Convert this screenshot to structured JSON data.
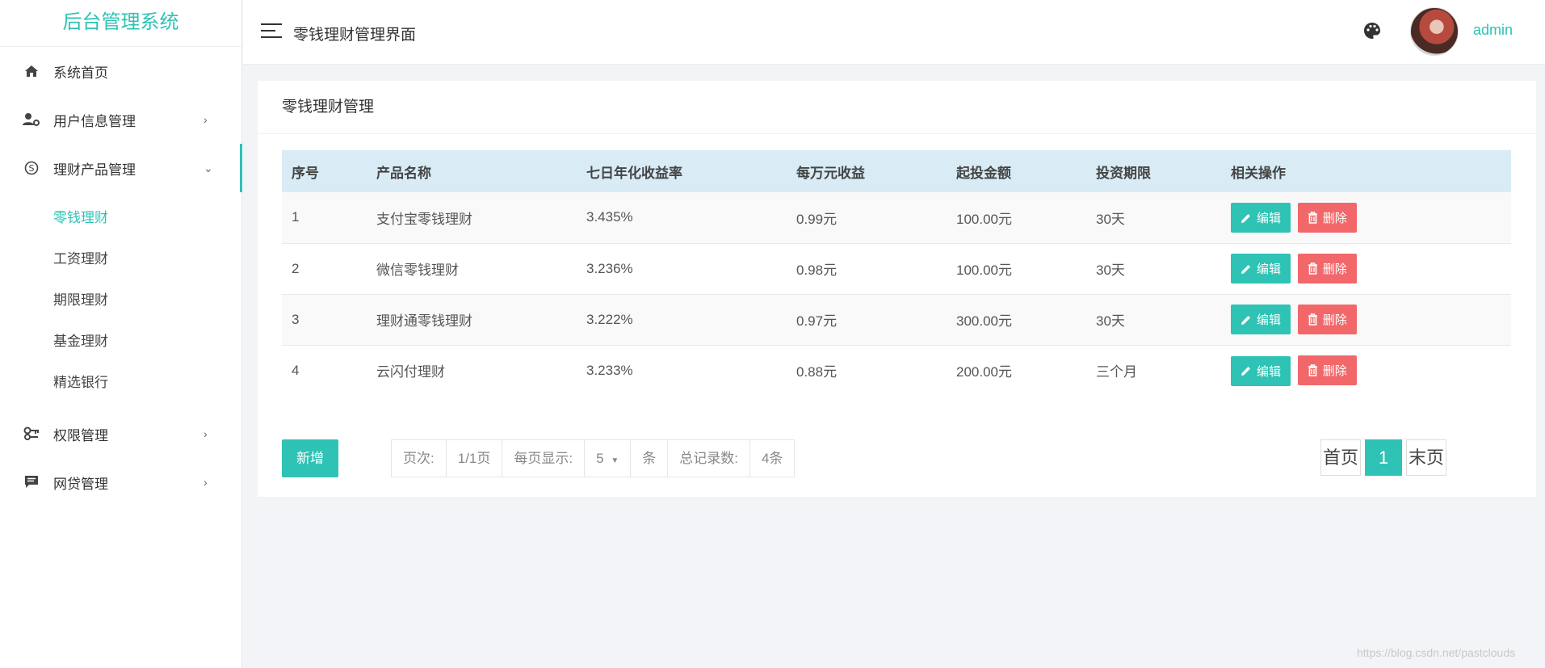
{
  "sidebar": {
    "title": "后台管理系统",
    "items": [
      {
        "label": "系统首页",
        "icon": "home-icon"
      },
      {
        "label": "用户信息管理",
        "icon": "user-gear-icon",
        "chevron": "›"
      },
      {
        "label": "理财产品管理",
        "icon": "skype-icon",
        "chevron": "⌄"
      },
      {
        "label": "权限管理",
        "icon": "key-icon",
        "chevron": "›"
      },
      {
        "label": "网贷管理",
        "icon": "comment-icon",
        "chevron": "›"
      }
    ],
    "subitems": [
      "零钱理财",
      "工资理财",
      "期限理财",
      "基金理财",
      "精选银行"
    ]
  },
  "header": {
    "title": "零钱理财管理界面",
    "username": "admin"
  },
  "card": {
    "title": "零钱理财管理"
  },
  "table": {
    "columns": [
      "序号",
      "产品名称",
      "七日年化收益率",
      "每万元收益",
      "起投金额",
      "投资期限",
      "相关操作"
    ],
    "rows": [
      {
        "id": "1",
        "name": "支付宝零钱理财",
        "rate": "3.435%",
        "profit": "0.99元",
        "min": "100.00元",
        "term": "30天"
      },
      {
        "id": "2",
        "name": "微信零钱理财",
        "rate": "3.236%",
        "profit": "0.98元",
        "min": "100.00元",
        "term": "30天"
      },
      {
        "id": "3",
        "name": "理财通零钱理财",
        "rate": "3.222%",
        "profit": "0.97元",
        "min": "300.00元",
        "term": "30天"
      },
      {
        "id": "4",
        "name": "云闪付理财",
        "rate": "3.233%",
        "profit": "0.88元",
        "min": "200.00元",
        "term": "三个月"
      }
    ],
    "edit_label": "编辑",
    "delete_label": "删除"
  },
  "footer": {
    "add_label": "新增",
    "page_label": "页次:",
    "page_value": "1/1页",
    "per_page_label": "每页显示:",
    "per_page_value": "5",
    "per_page_unit": "条",
    "total_label": "总记录数:",
    "total_value": "4条",
    "first_label": "首页",
    "current_page": "1",
    "last_label": "末页"
  },
  "watermark": "https://blog.csdn.net/pastclouds",
  "colors": {
    "accent": "#2ec3b4",
    "danger": "#f2686a",
    "header_bg": "#d9ecf5"
  }
}
